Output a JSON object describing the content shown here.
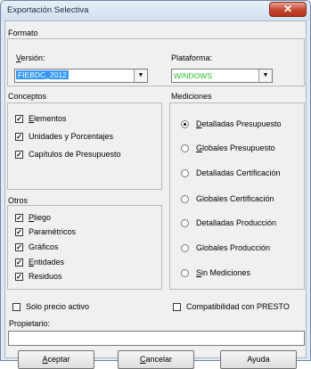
{
  "window": {
    "title": "Exportación Selectiva",
    "close_symbol": "✕"
  },
  "formato": {
    "label": "Formato",
    "version": {
      "label": "Versión:",
      "value": "FIEBDC_2012"
    },
    "plataforma": {
      "label": "Plataforma:",
      "value": "WINDOWS",
      "value_color": "#22c02a"
    }
  },
  "conceptos": {
    "label": "Conceptos",
    "items": [
      {
        "label": "Elementos",
        "checked": true
      },
      {
        "label": "Unidades y Porcentajes",
        "checked": true
      },
      {
        "label": "Capítulos de Presupuesto",
        "checked": true
      }
    ]
  },
  "otros": {
    "label": "Otros",
    "items": [
      {
        "label": "Pliego",
        "checked": true
      },
      {
        "label": "Paramétricos",
        "checked": true
      },
      {
        "label": "Gráficos",
        "checked": true
      },
      {
        "label": "Entidades",
        "checked": true
      },
      {
        "label": "Residuos",
        "checked": true
      }
    ]
  },
  "mediciones": {
    "label": "Mediciones",
    "selected": "Detalladas Presupuesto",
    "options": [
      "Detalladas Presupuesto",
      "Globales Presupuesto",
      "Detalladas Certificación",
      "Globales Certificación",
      "Detalladas Producción",
      "Globales Producción",
      "Sin Mediciones"
    ]
  },
  "solo_precio": {
    "label": "Solo precio activo",
    "checked": false
  },
  "compatibilidad": {
    "label": "Compatibilidad con PRESTO",
    "checked": false
  },
  "propietario": {
    "label": "Propietario:",
    "value": ""
  },
  "buttons": {
    "aceptar": "Aceptar",
    "cancelar": "Cancelar",
    "ayuda": "Ayuda"
  },
  "check_mark": "✓",
  "dropdown_glyph": "▼"
}
